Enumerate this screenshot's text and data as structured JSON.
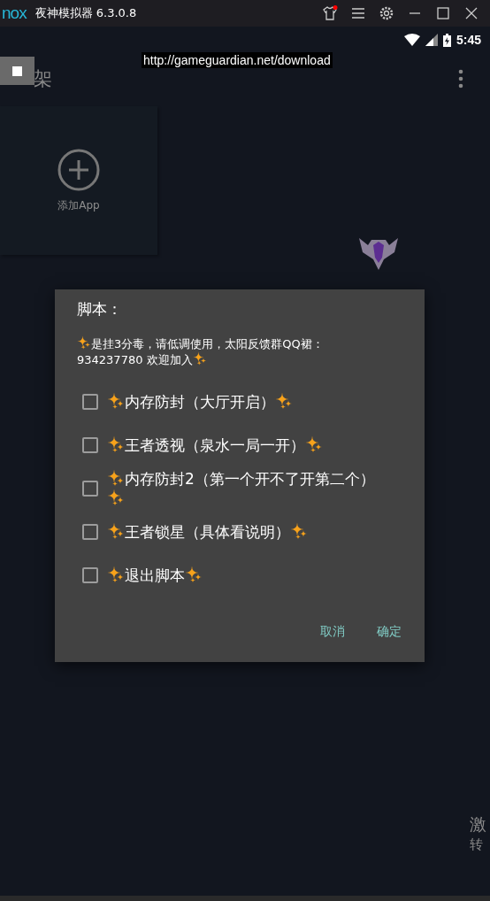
{
  "title_bar": {
    "logo": "nox",
    "title": "夜神模拟器 6.3.0.8"
  },
  "status_bar": {
    "time": "5:45"
  },
  "toast": "http://gameguardian.net/download",
  "app_bar": {
    "title": "架"
  },
  "shelf": {
    "add_label": "添加App"
  },
  "dialog": {
    "title": "脚本：",
    "message": "是挂3分毒，请低调使用，太阳反馈群QQ裙：934237780 欢迎加入",
    "options": [
      {
        "label": "内存防封（大厅开启）",
        "checked": false
      },
      {
        "label": "王者透视（泉水一局一开）",
        "checked": false
      },
      {
        "label": "内存防封2（第一个开不了开第二个）",
        "checked": false
      },
      {
        "label": "王者锁星（具体看说明）",
        "checked": false
      },
      {
        "label": "退出脚本",
        "checked": false
      }
    ],
    "buttons": [
      "取消",
      "确定"
    ]
  },
  "side_panel": {
    "line_1": "激",
    "line_2": "转"
  }
}
